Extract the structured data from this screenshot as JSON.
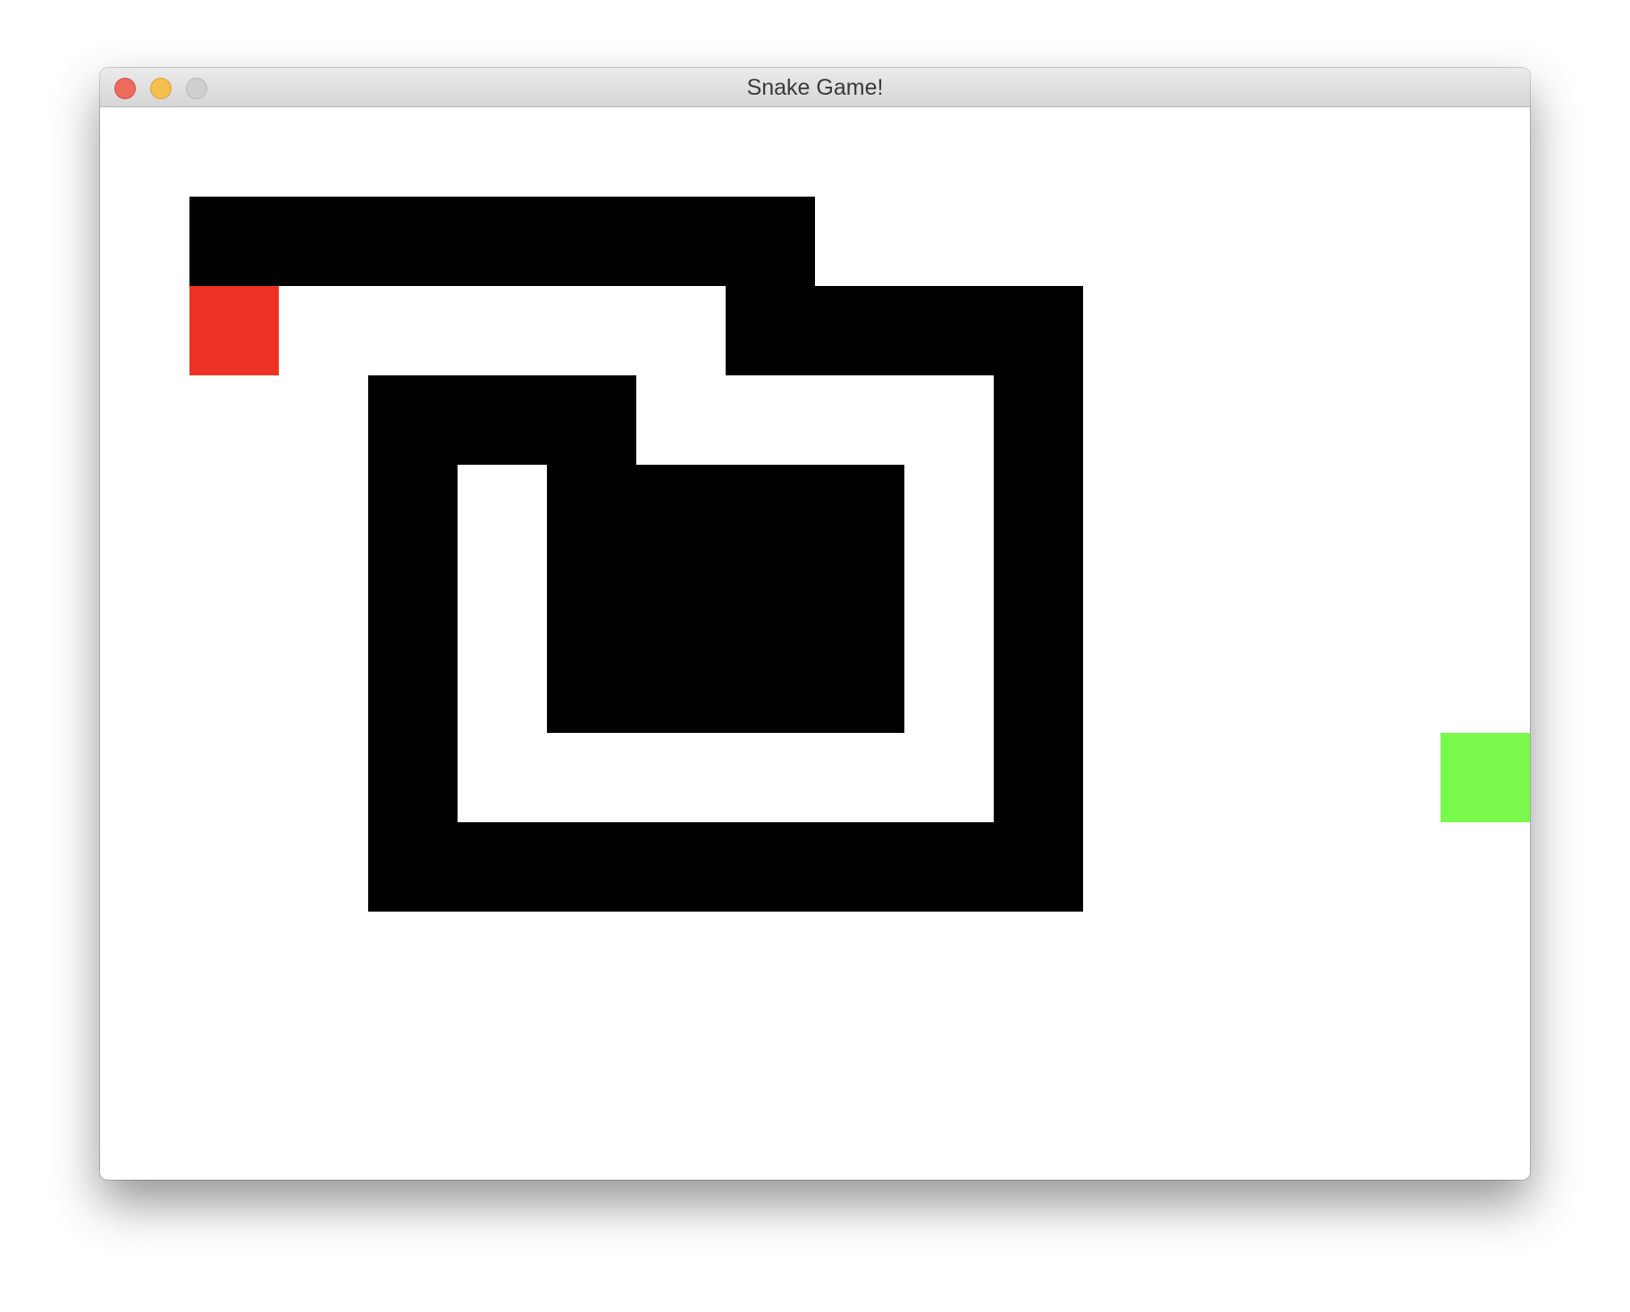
{
  "window": {
    "title": "Snake Game!",
    "buttons": {
      "close": "close",
      "minimize": "minimize",
      "zoom": "zoom"
    }
  },
  "game": {
    "grid_columns": 16,
    "grid_rows": 12,
    "colors": {
      "background": "#ffffff",
      "snake": "#000000",
      "head": "#ec3323",
      "food": "#78f94c"
    },
    "head": [
      1,
      2
    ],
    "food": [
      15,
      7
    ],
    "snake_cells": [
      [
        1,
        1
      ],
      [
        2,
        1
      ],
      [
        3,
        1
      ],
      [
        4,
        1
      ],
      [
        5,
        1
      ],
      [
        6,
        1
      ],
      [
        7,
        1
      ],
      [
        7,
        2
      ],
      [
        8,
        2
      ],
      [
        9,
        2
      ],
      [
        10,
        2
      ],
      [
        10,
        3
      ],
      [
        10,
        4
      ],
      [
        10,
        5
      ],
      [
        10,
        6
      ],
      [
        10,
        7
      ],
      [
        10,
        8
      ],
      [
        9,
        8
      ],
      [
        8,
        8
      ],
      [
        7,
        8
      ],
      [
        6,
        8
      ],
      [
        5,
        8
      ],
      [
        4,
        8
      ],
      [
        3,
        8
      ],
      [
        3,
        7
      ],
      [
        3,
        6
      ],
      [
        3,
        5
      ],
      [
        3,
        4
      ],
      [
        3,
        3
      ],
      [
        4,
        3
      ],
      [
        5,
        3
      ],
      [
        5,
        4
      ],
      [
        6,
        4
      ],
      [
        7,
        4
      ],
      [
        8,
        4
      ],
      [
        8,
        5
      ],
      [
        7,
        5
      ],
      [
        6,
        5
      ],
      [
        5,
        5
      ],
      [
        5,
        6
      ],
      [
        6,
        6
      ],
      [
        7,
        6
      ],
      [
        8,
        6
      ]
    ]
  }
}
